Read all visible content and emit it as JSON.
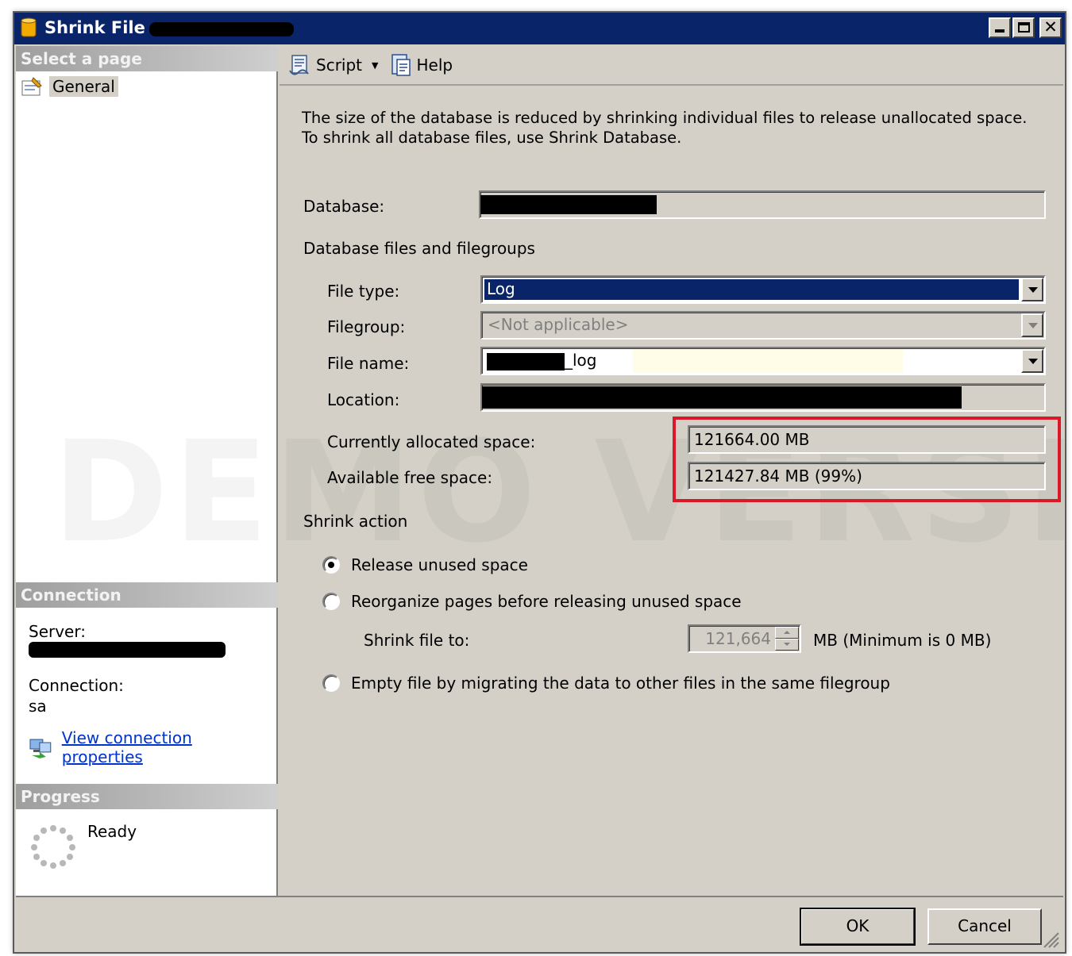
{
  "window": {
    "title": "Shrink File -",
    "controls": {
      "minimize": "_",
      "maximize": "□",
      "close": "✕"
    }
  },
  "left_pane": {
    "select_page_header": "Select a page",
    "pages": [
      {
        "label": "General",
        "icon": "properties-page-icon"
      }
    ],
    "connection_header": "Connection",
    "server_label": "Server:",
    "connection_label": "Connection:",
    "connection_value": "sa",
    "view_connection_link": "View connection properties",
    "progress_header": "Progress",
    "progress_status": "Ready"
  },
  "toolbar": {
    "script_label": "Script",
    "help_label": "Help"
  },
  "main": {
    "description": "The size of the database is reduced by shrinking individual files to release unallocated space. To shrink all database files, use Shrink Database.",
    "database_label": "Database:",
    "files_section_label": "Database files and filegroups",
    "file_type_label": "File type:",
    "file_type_value": "Log",
    "filegroup_label": "Filegroup:",
    "filegroup_value": "<Not applicable>",
    "file_name_label": "File name:",
    "file_name_suffix": "_log",
    "location_label": "Location:",
    "allocated_label": "Currently allocated space:",
    "allocated_value": "121664.00 MB",
    "free_label": "Available free space:",
    "free_value": "121427.84 MB (99%)",
    "shrink_action_label": "Shrink action",
    "options": {
      "release": "Release unused space",
      "reorganize": "Reorganize pages before releasing unused space",
      "empty": "Empty file by migrating the data to other files in the same filegroup"
    },
    "selected_option": "release",
    "shrink_to_label": "Shrink file to:",
    "shrink_to_value": "121,664",
    "shrink_to_unit": "MB (Minimum is 0 MB)"
  },
  "buttons": {
    "ok": "OK",
    "cancel": "Cancel"
  },
  "watermark": "DEMO VERSION",
  "colors": {
    "titlebar": "#0a246a",
    "dialog_face": "#d4d0c8",
    "selection": "#0a246a",
    "highlight_box": "#d9192a",
    "link": "#0033cc"
  }
}
